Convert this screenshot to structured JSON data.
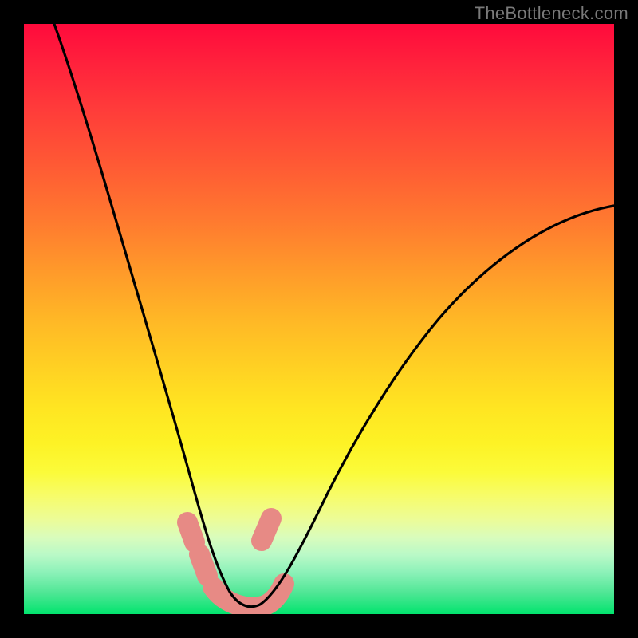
{
  "watermark": "TheBottleneck.com",
  "colors": {
    "frame": "#000000",
    "curve": "#000000",
    "highlight": "#e78a85",
    "gradient_top": "#ff0a3c",
    "gradient_bottom": "#02e46e"
  },
  "chart_data": {
    "type": "line",
    "title": "",
    "xlabel": "",
    "ylabel": "",
    "xlim": [
      0,
      100
    ],
    "ylim": [
      0,
      100
    ],
    "grid": false,
    "series": [
      {
        "name": "bottleneck-curve",
        "x": [
          5,
          8,
          12,
          16,
          20,
          24,
          26,
          28,
          30,
          32,
          34,
          36,
          38,
          42,
          48,
          54,
          60,
          66,
          72,
          78,
          84,
          90,
          96,
          100
        ],
        "y": [
          100,
          87,
          72,
          58,
          45,
          32,
          25,
          18,
          12,
          7,
          3,
          1,
          1,
          3,
          9,
          17,
          25,
          33,
          40,
          47,
          53,
          58,
          63,
          66
        ]
      }
    ],
    "annotations": [
      {
        "name": "optimal-range-highlight",
        "color": "#e78a85",
        "x": [
          28,
          30,
          32,
          34,
          36,
          38,
          40,
          42,
          44
        ],
        "y": [
          15,
          9,
          5,
          2,
          1,
          1,
          2,
          4,
          8
        ]
      }
    ]
  }
}
